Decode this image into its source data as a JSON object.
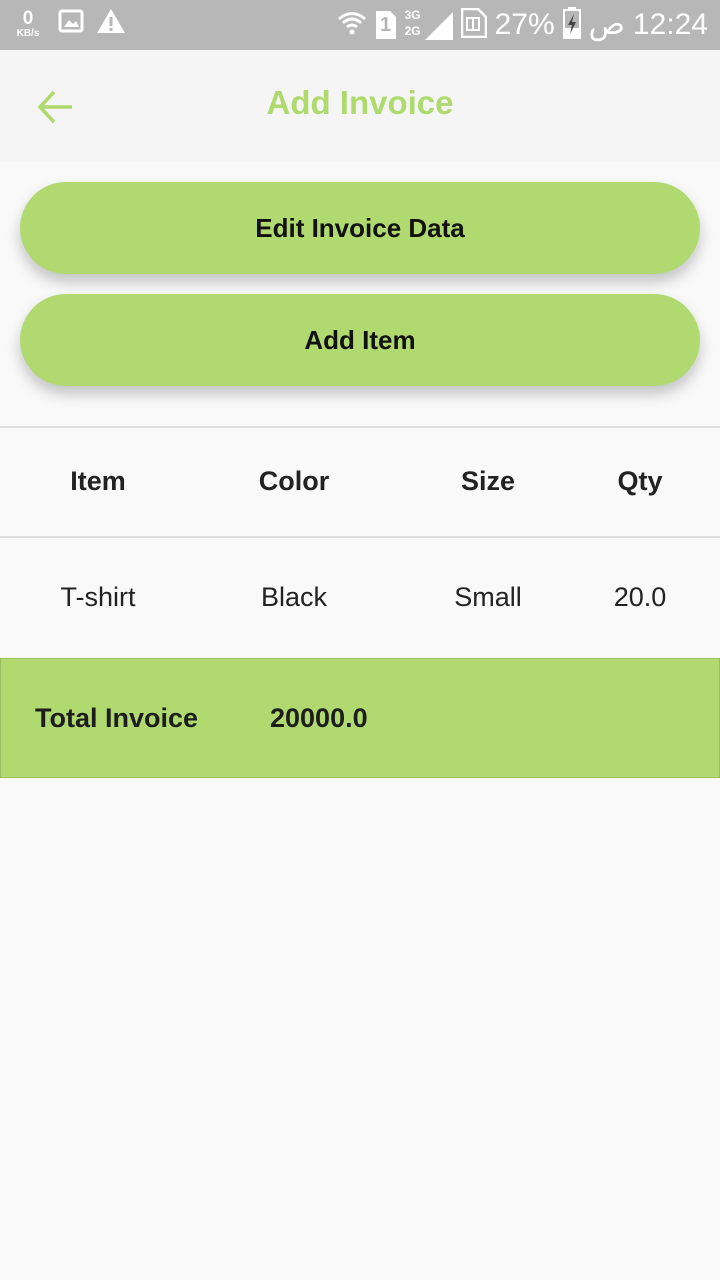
{
  "status_bar": {
    "net_speed_value": "0",
    "net_speed_unit": "KB/s",
    "sim_slot": "1",
    "net_type_top": "3G",
    "net_type_bottom": "2G",
    "battery_percent": "27%",
    "am_pm": "ص",
    "time": "12:24",
    "icons": [
      "image-icon",
      "warning-icon",
      "wifi-icon",
      "sim-icon",
      "signal-icon",
      "sim-card-icon",
      "battery-charging-icon"
    ]
  },
  "app_bar": {
    "back_icon": "arrow-left-icon",
    "title": "Add Invoice"
  },
  "actions": {
    "edit_invoice_label": "Edit Invoice Data",
    "add_item_label": "Add Item"
  },
  "table": {
    "columns": [
      "Item",
      "Color",
      "Size",
      "Qty"
    ],
    "rows": [
      [
        "T-shirt",
        "Black",
        "Small",
        "20.0"
      ]
    ]
  },
  "total": {
    "label": "Total Invoice",
    "value": "20000.0"
  },
  "colors": {
    "accent": "#b0da6f",
    "title": "#afda6e",
    "status_bar": "#b7b7b7",
    "background": "#f9f9f9"
  }
}
